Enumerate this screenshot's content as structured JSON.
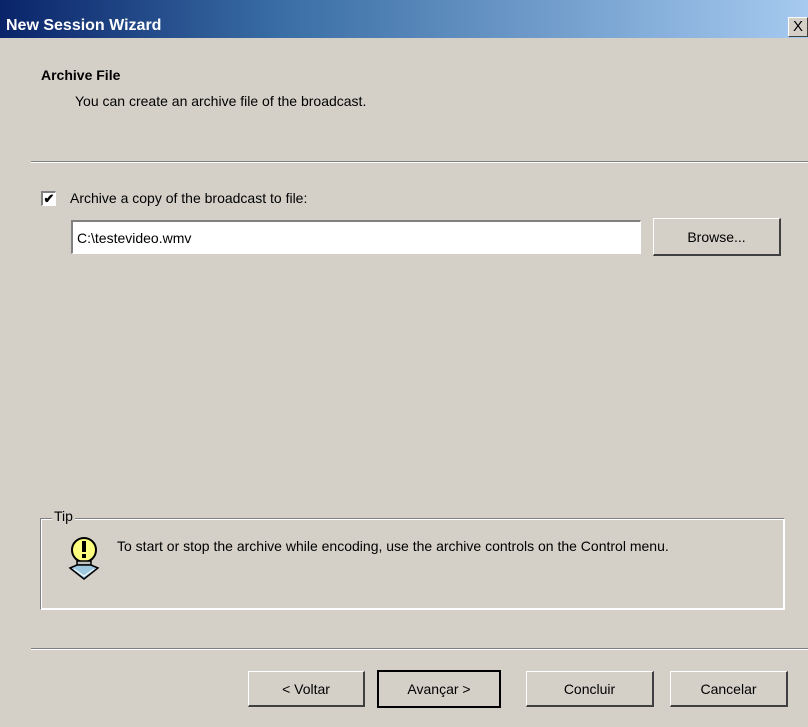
{
  "window": {
    "title": "New Session Wizard",
    "close_label": "X"
  },
  "header": {
    "title": "Archive File",
    "subtitle": "You can create an archive file of the broadcast."
  },
  "archive": {
    "checked": true,
    "checkbox_mark": "✔",
    "label": "Archive a copy of the broadcast to file:",
    "file_path": "C:\\testevideo.wmv",
    "browse_label": "Browse..."
  },
  "tip": {
    "legend": "Tip",
    "icon": "lightbulb-icon",
    "text": "To start or stop the archive while encoding, use the archive controls on the Control menu."
  },
  "footer": {
    "back_label": "< Voltar",
    "next_label": "Avançar >",
    "finish_label": "Concluir",
    "cancel_label": "Cancelar"
  },
  "colors": {
    "title_bar_start": "#0a246a",
    "title_bar_end": "#a6caf0",
    "face": "#d4d0c8"
  }
}
